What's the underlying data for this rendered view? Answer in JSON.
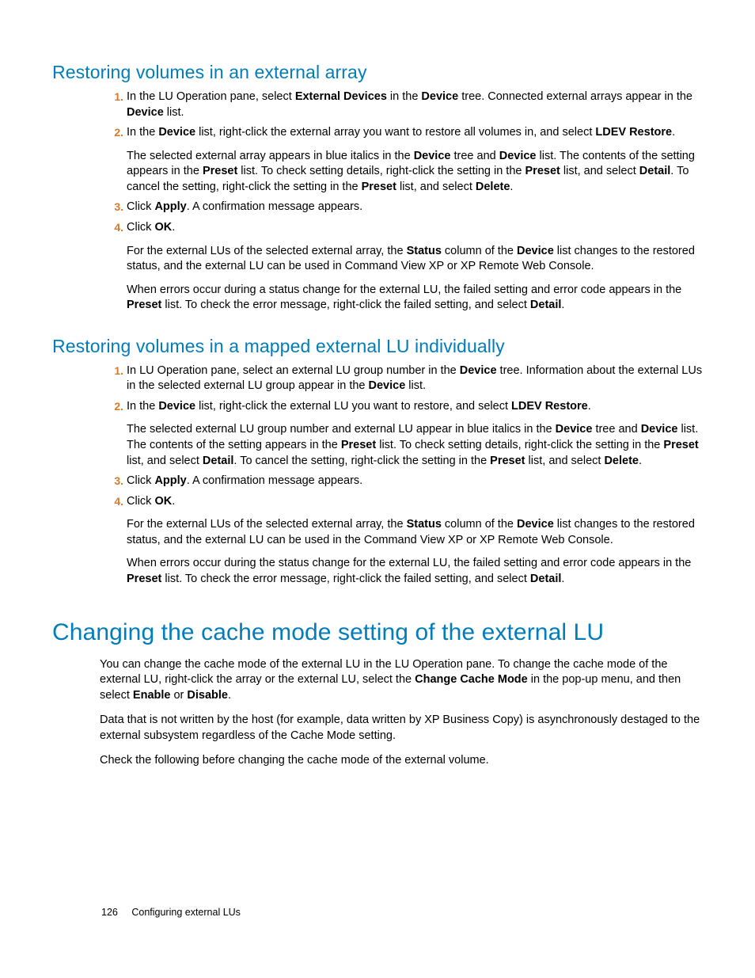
{
  "section1": {
    "title": "Restoring volumes in an external array",
    "steps": [
      {
        "num": "1.",
        "html": "In the LU Operation pane, select <b>External Devices</b> in the <b>Device</b> tree. Connected external arrays appear in the <b>Device</b> list."
      },
      {
        "num": "2.",
        "html": "In the <b>Device</b> list, right-click the external array you want to restore all volumes in, and select <b>LDEV Restore</b>.",
        "follow": "The selected external array appears in blue italics in the <b>Device</b> tree and <b>Device</b> list. The contents of the setting appears in the <b>Preset</b> list. To check setting details, right-click the setting in the <b>Preset</b> list, and select <b>Detail</b>. To cancel the setting, right-click the setting in the <b>Preset</b> list, and select <b>Delete</b>."
      },
      {
        "num": "3.",
        "html": "Click <b>Apply</b>. A confirmation message appears."
      },
      {
        "num": "4.",
        "html": "Click <b>OK</b>.",
        "follow": "For the external LUs of the selected external array, the <b>Status</b> column of the <b>Device</b> list changes to the restored status, and the external LU can be used in Command View XP or XP Remote Web Console.",
        "follow2": "When errors occur during a status change for the external LU, the failed setting and error code appears in the <b>Preset</b> list. To check the error message, right-click the failed setting, and select <b>Detail</b>."
      }
    ]
  },
  "section2": {
    "title": "Restoring volumes in a mapped external LU individually",
    "steps": [
      {
        "num": "1.",
        "html": "In LU Operation pane, select an external LU group number in the <b>Device</b> tree. Information about the external LUs in the selected external LU group appear in the <b>Device</b> list."
      },
      {
        "num": "2.",
        "html": "In the <b>Device</b> list, right-click the external LU you want to restore, and select <b>LDEV Restore</b>.",
        "follow": "The selected external LU group number and external LU appear in blue italics in the <b>Device</b> tree and <b>Device</b> list. The contents of the setting appears in the <b>Preset</b> list. To check setting details, right-click the setting in the <b>Preset</b> list, and select <b>Detail</b>. To cancel the setting, right-click the setting in the <b>Preset</b> list, and select <b>Delete</b>."
      },
      {
        "num": "3.",
        "html": "Click <b>Apply</b>. A confirmation message appears."
      },
      {
        "num": "4.",
        "html": "Click <b>OK</b>.",
        "follow": "For the external LUs of the selected external array, the <b>Status</b> column of the <b>Device</b> list changes to the restored status, and the external LU can be used in the Command View XP or XP Remote Web Console.",
        "follow2": "When errors occur during the status change for the external LU, the failed setting and error code appears in the <b>Preset</b> list. To check the error message, right-click the failed setting, and select <b>Detail</b>."
      }
    ]
  },
  "section3": {
    "title": "Changing the cache mode setting of the external LU",
    "paras": [
      "You can change the cache mode of the external LU in the LU Operation pane. To change the cache mode of the external LU, right-click the array or the external LU, select the <b>Change Cache Mode</b> in the pop-up menu, and then select <b>Enable</b> or <b>Disable</b>.",
      "Data that is not written by the host (for example, data written by XP Business Copy) is asynchronously destaged to the external subsystem regardless of the Cache Mode setting.",
      "Check the following before changing the cache mode of the external volume."
    ]
  },
  "footer": {
    "page": "126",
    "chapter": "Configuring external LUs"
  }
}
